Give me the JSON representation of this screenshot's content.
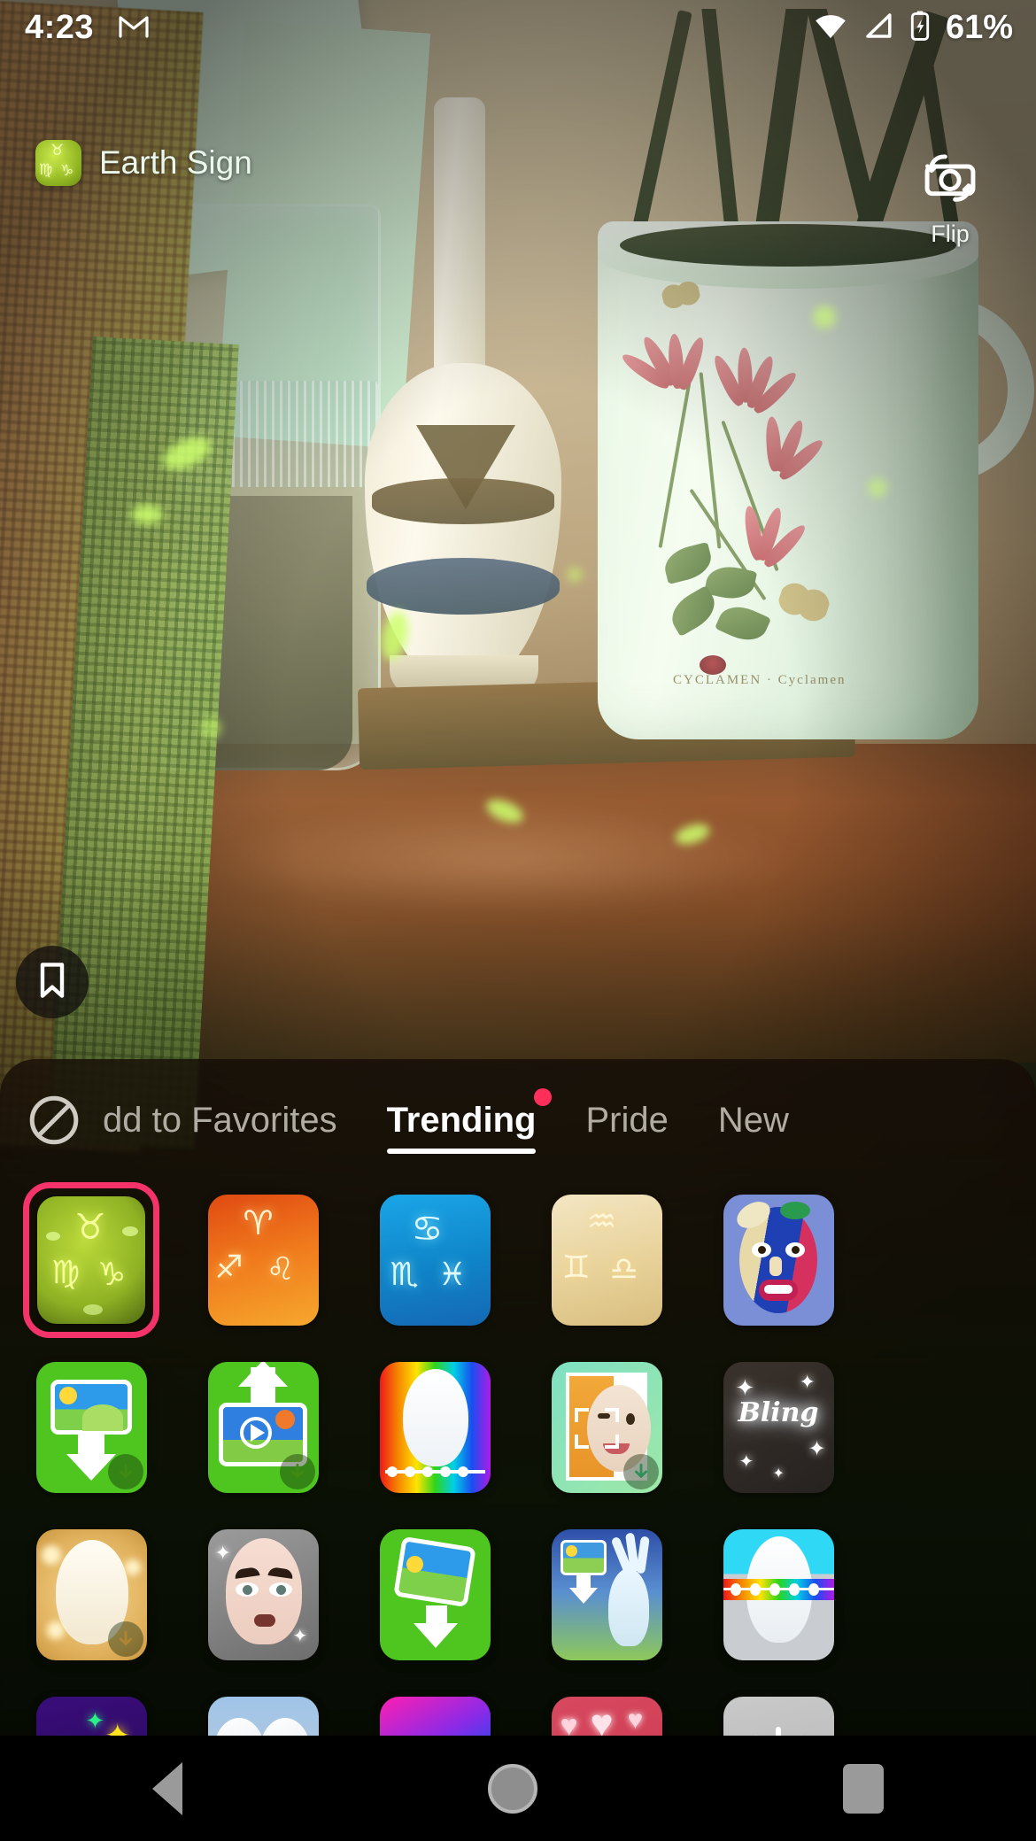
{
  "status_bar": {
    "time": "4:23",
    "notification_icon": "gmail-icon",
    "wifi_icon": "wifi-icon",
    "signal_icon": "cell-signal-icon",
    "battery_icon": "battery-charging-icon",
    "battery_percent": "61%"
  },
  "camera": {
    "lens_chip": {
      "label": "Earth Sign",
      "icon": "zodiac-earth-icon",
      "glyphs": [
        "♉",
        "♍",
        "♑"
      ]
    },
    "flip_button": {
      "label": "Flip",
      "icon": "camera-flip-icon"
    },
    "save_button": {
      "icon": "bookmark-icon"
    }
  },
  "panel": {
    "block_icon": "block-circle-slash-icon",
    "tabs": [
      {
        "label": "dd to Favorites",
        "active": false,
        "clipped": true,
        "badge": false
      },
      {
        "label": "Trending",
        "active": true,
        "clipped": false,
        "badge": true
      },
      {
        "label": "Pride",
        "active": false,
        "clipped": false,
        "badge": false
      },
      {
        "label": "New",
        "active": false,
        "clipped": false,
        "badge": false
      }
    ],
    "selected_tile_border_color": "#f5336b",
    "lenses": [
      {
        "name": "earth-sign-lens",
        "art": "zodiac-earth",
        "selected": true,
        "download": false
      },
      {
        "name": "fire-sign-lens",
        "art": "zodiac-fire",
        "selected": false,
        "download": false
      },
      {
        "name": "water-sign-lens",
        "art": "zodiac-water",
        "selected": false,
        "download": false
      },
      {
        "name": "air-sign-lens",
        "art": "zodiac-air",
        "selected": false,
        "download": false
      },
      {
        "name": "face-mask-lens",
        "art": "face-mask",
        "selected": false,
        "download": false
      },
      {
        "name": "photo-download-lens",
        "art": "photo-download",
        "selected": false,
        "download": true
      },
      {
        "name": "video-upload-lens",
        "art": "video-upload",
        "selected": false,
        "download": true
      },
      {
        "name": "rainbow-face-lens",
        "art": "rainbow-face",
        "selected": false,
        "download": false
      },
      {
        "name": "face-scan-lens",
        "art": "face-scan",
        "selected": false,
        "download": true
      },
      {
        "name": "bling-lens",
        "art": "bling",
        "selected": false,
        "download": false
      },
      {
        "name": "golden-glow-lens",
        "art": "golden-glow",
        "selected": false,
        "download": true
      },
      {
        "name": "glam-makeup-lens",
        "art": "glam-makeup",
        "selected": false,
        "download": false
      },
      {
        "name": "photo-drop-lens",
        "art": "photo-drop",
        "selected": false,
        "download": false
      },
      {
        "name": "wave-photo-lens",
        "art": "wave-photo",
        "selected": false,
        "download": false
      },
      {
        "name": "rainbow-band-lens",
        "art": "rainbow-band",
        "selected": false,
        "download": false
      },
      {
        "name": "purple-sparkle-lens",
        "art": "purple-sparkle",
        "selected": false,
        "download": false
      },
      {
        "name": "googly-eyes-lens",
        "art": "googly-eyes",
        "selected": false,
        "download": false
      },
      {
        "name": "neon-gradient-lens",
        "art": "neon-gradient",
        "selected": false,
        "download": false
      },
      {
        "name": "hearts-lens",
        "art": "hearts",
        "selected": false,
        "download": false
      },
      {
        "name": "loading-lens",
        "art": "loading",
        "selected": false,
        "download": false
      }
    ],
    "bling_text": "Bling"
  },
  "nav_bar": {
    "back": "back-triangle-icon",
    "home": "home-circle-icon",
    "recents": "recents-square-icon"
  }
}
